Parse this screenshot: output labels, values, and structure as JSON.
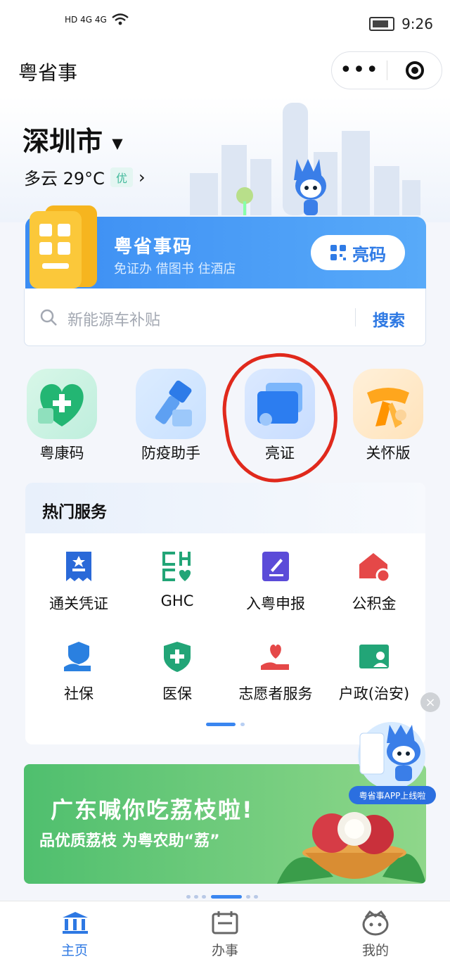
{
  "status_bar": {
    "left_text": "HD 4G 4G",
    "time": "9:26"
  },
  "title_bar": {
    "title": "粤省事"
  },
  "location": {
    "city": "深圳市",
    "weather": "多云 29°C",
    "aqi": "优"
  },
  "code_card": {
    "title": "粤省事码",
    "subtitle": "免证办 借图书 住酒店",
    "button": "亮码"
  },
  "search": {
    "placeholder": "新能源车补贴",
    "button": "搜索"
  },
  "quick": [
    {
      "label": "粤康码"
    },
    {
      "label": "防疫助手"
    },
    {
      "label": "亮证"
    },
    {
      "label": "关怀版"
    }
  ],
  "hot": {
    "title": "热门服务",
    "items": [
      {
        "label": "通关凭证"
      },
      {
        "label": "GHC"
      },
      {
        "label": "入粤申报"
      },
      {
        "label": "公积金"
      },
      {
        "label": "社保"
      },
      {
        "label": "医保"
      },
      {
        "label": "志愿者服务"
      },
      {
        "label": "户政(治安)"
      }
    ]
  },
  "float": {
    "badge": "粤省事APP上线啦"
  },
  "banner": {
    "line1": "广东喊你吃荔枝啦!",
    "line2": "品优质荔枝 为粤农助“荔”"
  },
  "tabs": [
    {
      "label": "主页"
    },
    {
      "label": "办事"
    },
    {
      "label": "我的"
    }
  ],
  "colors": {
    "accent": "#2d78e3",
    "annotation": "#e0291c"
  }
}
